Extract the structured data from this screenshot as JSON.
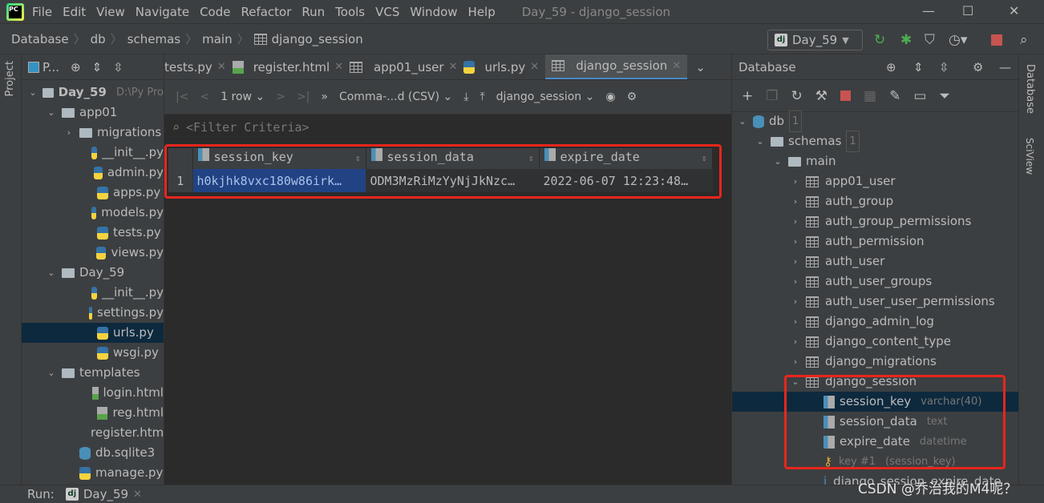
{
  "app": {
    "title": "Day_59 - django_session",
    "menu": [
      "File",
      "Edit",
      "View",
      "Navigate",
      "Code",
      "Refactor",
      "Run",
      "Tools",
      "VCS",
      "Window",
      "Help"
    ]
  },
  "breadcrumb": [
    "Database",
    "db",
    "schemas",
    "main",
    "django_session"
  ],
  "run_config": {
    "label": "Day_59"
  },
  "left_stripe": {
    "project_label": "Project"
  },
  "project": {
    "header": "P...",
    "tree": [
      {
        "label": "Day_59",
        "extra": "D:\\Py Pro",
        "depth": 0,
        "chev": "v",
        "icon": "folder",
        "bold": true
      },
      {
        "label": "app01",
        "depth": 1,
        "chev": "v",
        "icon": "folder"
      },
      {
        "label": "migrations",
        "depth": 2,
        "chev": ">",
        "icon": "folder"
      },
      {
        "label": "__init__.py",
        "depth": 3,
        "icon": "py"
      },
      {
        "label": "admin.py",
        "depth": 3,
        "icon": "py"
      },
      {
        "label": "apps.py",
        "depth": 3,
        "icon": "py"
      },
      {
        "label": "models.py",
        "depth": 3,
        "icon": "py"
      },
      {
        "label": "tests.py",
        "depth": 3,
        "icon": "py"
      },
      {
        "label": "views.py",
        "depth": 3,
        "icon": "py"
      },
      {
        "label": "Day_59",
        "depth": 1,
        "chev": "v",
        "icon": "folder"
      },
      {
        "label": "__init__.py",
        "depth": 3,
        "icon": "py"
      },
      {
        "label": "settings.py",
        "depth": 3,
        "icon": "py"
      },
      {
        "label": "urls.py",
        "depth": 3,
        "icon": "py",
        "selected": true
      },
      {
        "label": "wsgi.py",
        "depth": 3,
        "icon": "py"
      },
      {
        "label": "templates",
        "depth": 1,
        "chev": "v",
        "icon": "folder"
      },
      {
        "label": "login.html",
        "depth": 3,
        "icon": "html"
      },
      {
        "label": "reg.html",
        "depth": 3,
        "icon": "html"
      },
      {
        "label": "register.html",
        "depth": 3,
        "icon": "html"
      },
      {
        "label": "db.sqlite3",
        "depth": 2,
        "icon": "db"
      },
      {
        "label": "manage.py",
        "depth": 2,
        "icon": "py"
      }
    ]
  },
  "editor": {
    "tabs": [
      {
        "label": "tests.py",
        "icon": "py"
      },
      {
        "label": "register.html",
        "icon": "html"
      },
      {
        "label": "app01_user",
        "icon": "table"
      },
      {
        "label": "urls.py",
        "icon": "py"
      },
      {
        "label": "django_session",
        "icon": "table",
        "active": true
      }
    ],
    "toolbar": {
      "rows": "1 row",
      "format": "Comma-...d (CSV)",
      "datasource": "django_session"
    },
    "filter_placeholder": "<Filter Criteria>",
    "grid": {
      "columns": [
        "session_key",
        "session_data",
        "expire_date"
      ],
      "rows": [
        {
          "num": "1",
          "cells": [
            "h0kjhk8vxc180w86irk…",
            "ODM3MzRiMzYyNjJkNzc…",
            "2022-06-07 12:23:48…"
          ]
        }
      ]
    }
  },
  "database": {
    "header": "Database",
    "tree": [
      {
        "label": "db",
        "badge": "1",
        "depth": 0,
        "chev": "v",
        "icon": "db"
      },
      {
        "label": "schemas",
        "badge": "1",
        "depth": 1,
        "chev": "v",
        "icon": "folder"
      },
      {
        "label": "main",
        "depth": 2,
        "chev": "v",
        "icon": "schema"
      },
      {
        "label": "app01_user",
        "depth": 3,
        "chev": ">",
        "icon": "table"
      },
      {
        "label": "auth_group",
        "depth": 3,
        "chev": ">",
        "icon": "table"
      },
      {
        "label": "auth_group_permissions",
        "depth": 3,
        "chev": ">",
        "icon": "table"
      },
      {
        "label": "auth_permission",
        "depth": 3,
        "chev": ">",
        "icon": "table"
      },
      {
        "label": "auth_user",
        "depth": 3,
        "chev": ">",
        "icon": "table"
      },
      {
        "label": "auth_user_groups",
        "depth": 3,
        "chev": ">",
        "icon": "table"
      },
      {
        "label": "auth_user_user_permissions",
        "depth": 3,
        "chev": ">",
        "icon": "table"
      },
      {
        "label": "django_admin_log",
        "depth": 3,
        "chev": ">",
        "icon": "table"
      },
      {
        "label": "django_content_type",
        "depth": 3,
        "chev": ">",
        "icon": "table"
      },
      {
        "label": "django_migrations",
        "depth": 3,
        "chev": ">",
        "icon": "table"
      },
      {
        "label": "django_session",
        "depth": 3,
        "chev": "v",
        "icon": "table"
      },
      {
        "label": "session_key",
        "type": "varchar(40)",
        "depth": 4,
        "icon": "column",
        "selected": true
      },
      {
        "label": "session_data",
        "type": "text",
        "depth": 4,
        "icon": "column"
      },
      {
        "label": "expire_date",
        "type": "datetime",
        "depth": 4,
        "icon": "column"
      },
      {
        "label": "key #1",
        "type": "(session_key)",
        "depth": 4,
        "icon": "key",
        "dim": true
      },
      {
        "label": "django_session_expire_date",
        "depth": 4,
        "icon": "index"
      }
    ]
  },
  "right_stripe": {
    "database_label": "Database",
    "sciview_label": "SciView"
  },
  "bottom": {
    "run_label": "Run:",
    "run_tab": "Day_59"
  },
  "watermark": "CSDN @乔治我的M4呢？",
  "colors": {
    "highlight_border": "#e8261c",
    "selection": "#214283",
    "accent": "#4a88c7"
  }
}
